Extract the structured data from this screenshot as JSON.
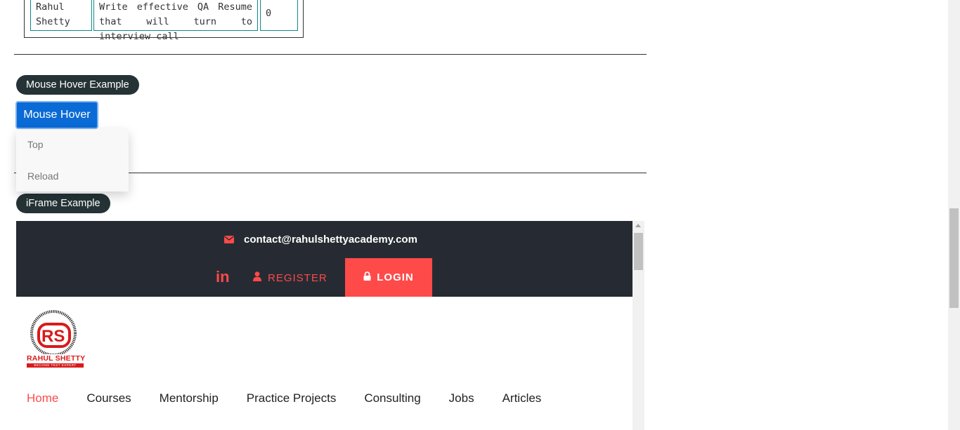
{
  "table": {
    "row": {
      "instructor": "Rahul Shetty",
      "course": "Write effective QA Resume that will turn to interview call",
      "price": "0"
    }
  },
  "mouse_hover_section": {
    "legend": "Mouse Hover Example",
    "button_label": "Mouse Hover",
    "menu_items": [
      "Top",
      "Reload"
    ]
  },
  "iframe_section": {
    "legend": "iFrame Example",
    "topbar": {
      "email": "contact@rahulshettyacademy.com",
      "linkedin_label": "in",
      "register_label": "REGISTER",
      "login_label": "LOGIN"
    },
    "logo": {
      "initials": "RS",
      "name": "RAHUL SHETTY",
      "tagline": "BECOME TEST EXPERT"
    },
    "nav": [
      "Home",
      "Courses",
      "Mentorship",
      "Practice Projects",
      "Consulting",
      "Jobs",
      "Articles"
    ]
  },
  "colors": {
    "accent_red": "#ff4a4a",
    "dark_bar": "#262b33",
    "pill_bg": "#253336",
    "button_blue": "#0a6ad6",
    "table_border": "#0e8a8a"
  }
}
